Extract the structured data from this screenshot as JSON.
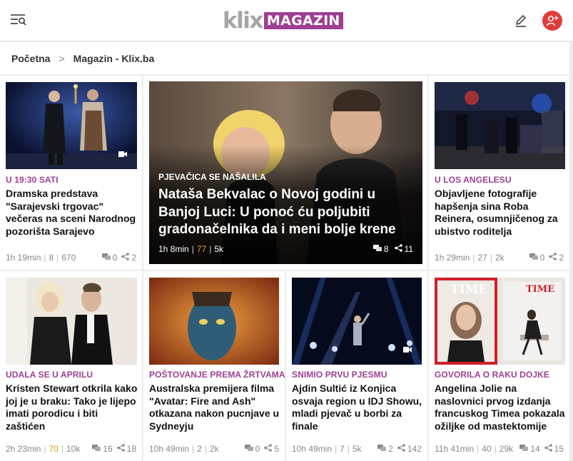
{
  "header": {
    "logo_klix": "klix",
    "logo_magazin": "MAGAZIN"
  },
  "breadcrumb": {
    "home": "Početna",
    "sep": ">",
    "current": "Magazin - Klix.ba"
  },
  "feature": {
    "kicker": "PJEVAČICA SE NAŠALILA",
    "title": "Nataša Bekvalac o Novoj godini u Banjoj Luci: U ponoć ću poljubiti gradonačelnika da i meni bolje krene",
    "time": "1h 8min",
    "reads": "77",
    "views": "5k",
    "comments": "8",
    "shares": "11"
  },
  "articles": [
    {
      "kicker": "U 19:30 SATI",
      "title": "Dramska predstava \"Sarajevski trgovac\" večeras na sceni Narodnog pozorišta Sarajevo",
      "time": "1h 19min",
      "reads": "8",
      "views": "670",
      "comments": "0",
      "shares": "2"
    },
    {
      "kicker": "U LOS ANGELESU",
      "title": "Objavljene fotografije hapšenja sina Roba Reinera, osumnjičenog za ubistvo roditelja",
      "time": "1h 29min",
      "reads": "27",
      "views": "2k",
      "comments": "0",
      "shares": "2"
    },
    {
      "kicker": "UDALA SE U APRILU",
      "title": "Kristen Stewart otkrila kako joj je u braku: Tako je lijepo imati porodicu i biti zaštićen",
      "time": "2h 23min",
      "reads": "70",
      "views": "10k",
      "comments": "16",
      "shares": "18"
    },
    {
      "kicker": "POŠTOVANJE PREMA ŽRTVAMA",
      "title": "Australska premijera filma \"Avatar: Fire and Ash\" otkazana nakon pucnjave u Sydneyju",
      "time": "10h 49min",
      "reads": "2",
      "views": "2k",
      "comments": "0",
      "shares": "5"
    },
    {
      "kicker": "SNIMIO PRVU PJESMU",
      "title": "Ajdin Sultić iz Konjica osvaja region u IDJ Showu, mladi pjevač u borbi za finale",
      "time": "10h 49min",
      "reads": "7",
      "views": "5k",
      "comments": "2",
      "shares": "142"
    },
    {
      "kicker": "GOVORILA O RAKU DOJKE",
      "title": "Angelina Jolie na naslovnici prvog izdanja francuskog Timea pokazala ožiljke od mastektomije",
      "time": "11h 41min",
      "reads": "40",
      "views": "29k",
      "comments": "14",
      "shares": "15",
      "cover_text_1": "TIME",
      "cover_text_2": "TIME"
    }
  ]
}
